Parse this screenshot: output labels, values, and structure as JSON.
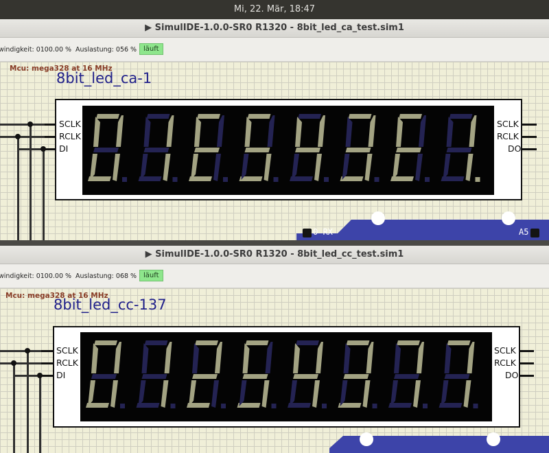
{
  "topbar": {
    "clock": "Mi, 22. Mär, 18:47"
  },
  "colors": {
    "lit": "#a3a383",
    "dim": "#242353",
    "panel": "#040404"
  },
  "windows": [
    {
      "title": "▶ SimulIDE-1.0.0-SR0 R1320 - 8bit_led_ca_test.sim1",
      "speed": "windigkeit: 0100.00 %",
      "load": "Auslastung: 056 %",
      "status": "läuft",
      "mcu": "Mcu: mega328 at 16 MHz",
      "component": "8bit_led_ca-1",
      "pins_left": [
        "SCLK",
        "RCLK",
        "DI"
      ],
      "pins_right": [
        "SCLK",
        "RCLK",
        "DO"
      ],
      "arduino": {
        "left": "0 RX",
        "right": "A5"
      },
      "digits": [
        {
          "segs": "abcdef",
          "dp": false
        },
        {
          "segs": "bc",
          "dp": false
        },
        {
          "segs": "afged",
          "dp": false
        },
        {
          "segs": "afgcd",
          "dp": false
        },
        {
          "segs": "fgbc",
          "dp": false
        },
        {
          "segs": "abcdg",
          "dp": false
        },
        {
          "segs": "afged",
          "dp": false
        },
        {
          "segs": "bc",
          "dp": true
        }
      ]
    },
    {
      "title": "▶ SimulIDE-1.0.0-SR0 R1320 - 8bit_led_cc_test.sim1",
      "speed": "windigkeit: 0100.00 %",
      "load": "Auslastung: 068 %",
      "status": "läuft",
      "mcu": "Mcu: mega328 at 16 MHz",
      "component": "8bit_led_cc-137",
      "pins_left": [
        "SCLK",
        "RCLK",
        "DI"
      ],
      "pins_right": [
        "SCLK",
        "RCLK",
        "DO"
      ],
      "digits": [
        {
          "segs": "abcdef",
          "dp": false
        },
        {
          "segs": "bc",
          "dp": false
        },
        {
          "segs": "abged",
          "dp": false
        },
        {
          "segs": "afgcd",
          "dp": false
        },
        {
          "segs": "fgbc",
          "dp": false
        },
        {
          "segs": "abcdg",
          "dp": false
        },
        {
          "segs": "abc",
          "dp": false
        },
        {
          "segs": "abc",
          "dp": false
        }
      ]
    }
  ]
}
